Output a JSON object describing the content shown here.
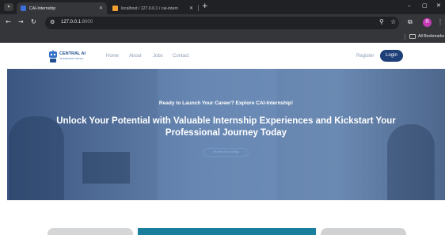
{
  "browser": {
    "tabs": [
      {
        "title": "CAI-Internship",
        "active": true
      },
      {
        "title": "localhost / 127.0.0.1 / cai-intern",
        "active": false
      }
    ],
    "new_tab": "+",
    "window_controls": {
      "minimize": "–",
      "maximize": "▢",
      "close": "✕"
    },
    "url_host": "127.0.0.1",
    "url_port": ":8000",
    "bookmarks_label": "All Bookmarks",
    "profile_initial": "R"
  },
  "site": {
    "logo_name": "CENTRAL AI",
    "logo_tagline": "INTERNSHIP PORTAL",
    "nav": [
      "Home",
      "About",
      "Jobs",
      "Contact"
    ],
    "register": "Register",
    "login": "Login"
  },
  "hero": {
    "pre_title": "Ready to Launch Your Career? Explore CAI-Internship!",
    "title": "Unlock Your Potential with Valuable Internship Experiences and Kickstart Your Professional Journey Today",
    "button": "Browse Job Listings"
  },
  "colors": {
    "accent": "#1e3f78",
    "hero_overlay": "#3a6096",
    "card_teal": "#1a7f9c",
    "profile": "#c53bb5"
  }
}
